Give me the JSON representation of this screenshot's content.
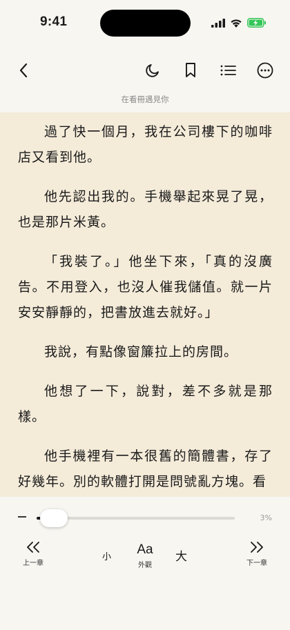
{
  "status": {
    "time": "9:41"
  },
  "book": {
    "title": "在看冊遇見你"
  },
  "content": {
    "paragraphs": [
      "過了快一個月，我在公司樓下的咖啡店又看到他。",
      "他先認出我的。手機舉起來晃了晃，也是那片米黃。",
      "「我裝了。」他坐下來，「真的沒廣告。不用登入，也沒人催我儲值。就一片安安靜靜的，把書放進去就好。」",
      "我說，有點像窗簾拉上的房間。",
      "他想了一下，說對，差不多就是那樣。",
      "他手機裡有一本很舊的簡體書，存了好幾年。別的軟體打開是問號亂方塊。看"
    ]
  },
  "progress": {
    "percent_label": "3%",
    "value": 0.03
  },
  "controls": {
    "prev_chapter": "上一章",
    "next_chapter": "下一章",
    "font_small": "小",
    "font_large": "大",
    "appearance_glyph": "Aa",
    "appearance_label": "外觀"
  },
  "icons": {
    "toolbar": [
      "back-icon",
      "night-mode-icon",
      "bookmark-icon",
      "toc-icon",
      "more-icon"
    ],
    "status": [
      "cellular-signal-icon",
      "wifi-icon",
      "battery-charging-icon"
    ]
  },
  "colors": {
    "page_bg": "#f4ebd9",
    "app_bg": "#f8f6f1",
    "battery_green": "#34c759"
  }
}
